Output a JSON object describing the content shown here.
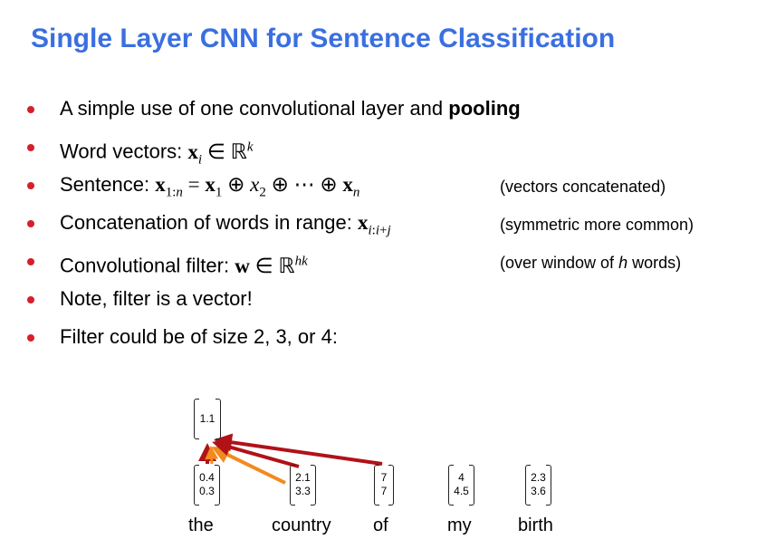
{
  "title": "Single Layer CNN for Sentence Classification",
  "bullets": [
    {
      "pre": "A simple use of one convolutional layer and ",
      "bold": "pooling"
    },
    {
      "pre": "Word vectors: "
    },
    {
      "pre": "Sentence: ",
      "note": "(vectors concatenated)"
    },
    {
      "pre": "Concatenation of words in range: ",
      "note": "(symmetric more common)"
    },
    {
      "pre": "Convolutional filter: ",
      "note_pre": "(over window of ",
      "note_italic": "h",
      "note_post": " words)"
    },
    {
      "pre": "Note, filter is a vector!"
    },
    {
      "pre": "Filter could be of size 2, 3, or 4:"
    }
  ],
  "diagram": {
    "output": [
      "1.1"
    ],
    "words": [
      {
        "word": "the",
        "values": [
          "0.4",
          "0.3"
        ]
      },
      {
        "word": "country",
        "values": [
          "2.1",
          "3.3"
        ]
      },
      {
        "word": "of",
        "values": [
          "7",
          "7"
        ]
      },
      {
        "word": "my",
        "values": [
          "4",
          "4.5"
        ]
      },
      {
        "word": "birth",
        "values": [
          "2.3",
          "3.6"
        ]
      }
    ],
    "colors": {
      "dark_red": "#b01218",
      "orange": "#f28a1e"
    }
  }
}
